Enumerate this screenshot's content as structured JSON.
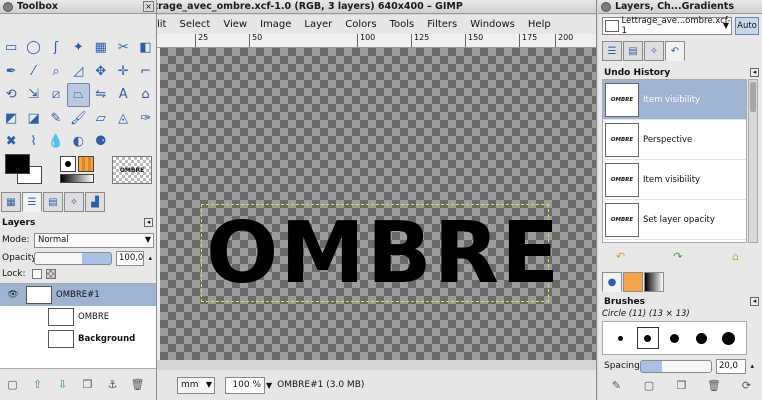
{
  "toolbox": {
    "title": "Toolbox",
    "tools": [
      {
        "name": "rect-select-icon",
        "glyph": "▭"
      },
      {
        "name": "ellipse-select-icon",
        "glyph": "◯"
      },
      {
        "name": "free-select-icon",
        "glyph": "ʃ"
      },
      {
        "name": "fuzzy-select-icon",
        "glyph": "✦"
      },
      {
        "name": "color-select-icon",
        "glyph": "▦"
      },
      {
        "name": "scissors-select-icon",
        "glyph": "✂"
      },
      {
        "name": "foreground-select-icon",
        "glyph": "◧"
      },
      {
        "name": "paths-icon",
        "glyph": "✒"
      },
      {
        "name": "color-picker-icon",
        "glyph": "⁄"
      },
      {
        "name": "zoom-icon",
        "glyph": "⌕"
      },
      {
        "name": "measure-icon",
        "glyph": "◿"
      },
      {
        "name": "move-icon",
        "glyph": "✥"
      },
      {
        "name": "align-icon",
        "glyph": "✛"
      },
      {
        "name": "crop-icon",
        "glyph": "⌐"
      },
      {
        "name": "rotate-icon",
        "glyph": "⟲"
      },
      {
        "name": "scale-icon",
        "glyph": "⇲"
      },
      {
        "name": "shear-icon",
        "glyph": "⧄"
      },
      {
        "name": "perspective-icon",
        "glyph": "⏢"
      },
      {
        "name": "flip-icon",
        "glyph": "⇋"
      },
      {
        "name": "text-icon",
        "glyph": "A"
      },
      {
        "name": "cage-icon",
        "glyph": "⌂"
      },
      {
        "name": "bucket-fill-icon",
        "glyph": "◩"
      },
      {
        "name": "blend-icon",
        "glyph": "◪"
      },
      {
        "name": "pencil-icon",
        "glyph": "✎"
      },
      {
        "name": "paintbrush-icon",
        "glyph": "🖌"
      },
      {
        "name": "eraser-icon",
        "glyph": "▱"
      },
      {
        "name": "airbrush-icon",
        "glyph": "◬"
      },
      {
        "name": "ink-icon",
        "glyph": "✑"
      },
      {
        "name": "clone-icon",
        "glyph": "✖"
      },
      {
        "name": "smudge-icon",
        "glyph": "⌇"
      },
      {
        "name": "blur-icon",
        "glyph": "💧"
      },
      {
        "name": "dodge-icon",
        "glyph": "◐"
      },
      {
        "name": "heal-icon",
        "glyph": "⚈"
      }
    ],
    "active_tool_index": 17,
    "image_thumb_label": "OMBRE"
  },
  "layers_panel": {
    "title": "Layers",
    "mode_label": "Mode:",
    "mode_value": "Normal",
    "opacity_label": "Opacity:",
    "opacity_value": "100,0",
    "opacity_fraction": 1.0,
    "lock_label": "Lock:",
    "layers": [
      {
        "name": "OMBRE#1",
        "selected": true,
        "visible": true,
        "bold": false
      },
      {
        "name": "OMBRE",
        "selected": false,
        "visible": false,
        "bold": false
      },
      {
        "name": "Background",
        "selected": false,
        "visible": false,
        "bold": true
      }
    ]
  },
  "image_window": {
    "title": "ttrage_avec_ombre.xcf-1.0 (RGB, 3 layers) 640x400 – GIMP",
    "menu": [
      "lit",
      "Select",
      "View",
      "Image",
      "Layer",
      "Colors",
      "Tools",
      "Filters",
      "Windows",
      "Help"
    ],
    "ruler_ticks": [
      "25",
      "|50",
      "|100",
      "|125",
      "|150",
      "|175",
      "|200"
    ],
    "canvas_text": "OMBRE",
    "status": {
      "unit": "mm",
      "zoom": "100 %",
      "info": "OMBRE#1 (3.0 MB)"
    }
  },
  "dock": {
    "title": "Layers, Ch...Gradients",
    "image_combo": "Lettrage_ave...ombre.xcf-1",
    "auto_button": "Auto",
    "undo_history_title": "Undo History",
    "history": [
      {
        "name": "Item visibility",
        "selected": true
      },
      {
        "name": "Perspective",
        "selected": false
      },
      {
        "name": "Item visibility",
        "selected": false
      },
      {
        "name": "Set layer opacity",
        "selected": false
      }
    ],
    "history_thumb_text": "OMBRE",
    "brushes_title": "Brushes",
    "brush_name": "Circle (11) (13 × 13)",
    "spacing_label": "Spacing:",
    "spacing_value": "20,0",
    "colors": {
      "selection": "#9eb4d2",
      "accent": "#2b5fa8"
    }
  }
}
